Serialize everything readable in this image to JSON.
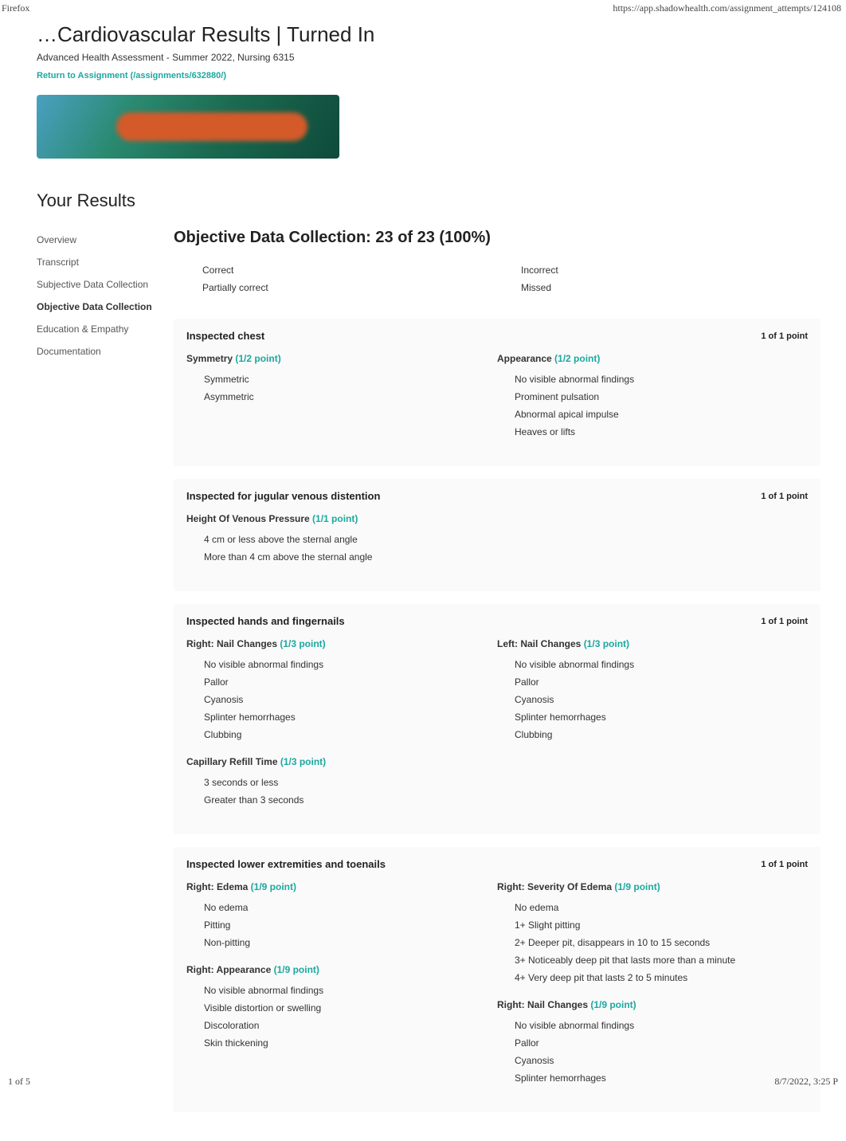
{
  "browser_label": "Firefox",
  "url": "https://app.shadowhealth.com/assignment_attempts/124108",
  "title": "…Cardiovascular Results | Turned In",
  "subtitle": "Advanced Health Assessment - Summer 2022, Nursing 6315",
  "return_link": "Return to Assignment (/assignments/632880/)",
  "section_title": "Your Results",
  "sidebar": {
    "items": [
      {
        "label": "Overview",
        "active": false
      },
      {
        "label": "Transcript",
        "active": false
      },
      {
        "label": "Subjective Data Collection",
        "active": false
      },
      {
        "label": "Objective Data Collection",
        "active": true
      },
      {
        "label": "Education & Empathy",
        "active": false
      },
      {
        "label": "Documentation",
        "active": false
      }
    ]
  },
  "main_heading": "Objective Data Collection: 23 of 23 (100%)",
  "legend": {
    "left": [
      {
        "label": "Correct"
      },
      {
        "label": "Partially correct"
      }
    ],
    "right": [
      {
        "label": "Incorrect"
      },
      {
        "label": "Missed"
      }
    ]
  },
  "cards": [
    {
      "title": "Inspected chest",
      "score": "1 of 1 point",
      "left": [
        {
          "title": "Symmetry",
          "points": "(1/2 point)",
          "options": [
            "Symmetric",
            "Asymmetric"
          ]
        }
      ],
      "right": [
        {
          "title": "Appearance",
          "points": "(1/2 point)",
          "options": [
            "No visible abnormal findings",
            "Prominent pulsation",
            "Abnormal apical impulse",
            "Heaves or lifts"
          ]
        }
      ]
    },
    {
      "title": "Inspected for jugular venous distention",
      "score": "1 of 1 point",
      "left": [
        {
          "title": "Height Of Venous Pressure",
          "points": "(1/1 point)",
          "options": [
            "4 cm or less above the sternal angle",
            "More than 4 cm above the sternal angle"
          ]
        }
      ],
      "right": []
    },
    {
      "title": "Inspected hands and fingernails",
      "score": "1 of 1 point",
      "left": [
        {
          "title": "Right: Nail Changes",
          "points": "(1/3 point)",
          "options": [
            "No visible abnormal findings",
            "Pallor",
            "Cyanosis",
            "Splinter hemorrhages",
            "Clubbing"
          ]
        },
        {
          "title": "Capillary Refill Time",
          "points": "(1/3 point)",
          "options": [
            "3 seconds or less",
            "Greater than 3 seconds"
          ]
        }
      ],
      "right": [
        {
          "title": "Left: Nail Changes",
          "points": "(1/3 point)",
          "options": [
            "No visible abnormal findings",
            "Pallor",
            "Cyanosis",
            "Splinter hemorrhages",
            "Clubbing"
          ]
        }
      ]
    },
    {
      "title": "Inspected lower extremities and toenails",
      "score": "1 of 1 point",
      "left": [
        {
          "title": "Right: Edema",
          "points": "(1/9 point)",
          "options": [
            "No edema",
            "Pitting",
            "Non-pitting"
          ]
        },
        {
          "title": "Right: Appearance",
          "points": "(1/9 point)",
          "options": [
            "No visible abnormal findings",
            "Visible distortion or swelling",
            "Discoloration",
            "Skin thickening"
          ]
        }
      ],
      "right": [
        {
          "title": "Right: Severity Of Edema",
          "points": "(1/9 point)",
          "options": [
            "No edema",
            "1+ Slight pitting",
            "2+ Deeper pit, disappears in 10 to 15 seconds",
            "3+ Noticeably deep pit that lasts more than a minute",
            "4+ Very deep pit that lasts 2 to 5 minutes"
          ]
        },
        {
          "title": "Right: Nail Changes",
          "points": "(1/9 point)",
          "options": [
            "No visible abnormal findings",
            "Pallor",
            "Cyanosis",
            "Splinter hemorrhages"
          ]
        }
      ]
    }
  ],
  "footer": {
    "left": "1 of 5",
    "right": "8/7/2022, 3:25 P"
  }
}
